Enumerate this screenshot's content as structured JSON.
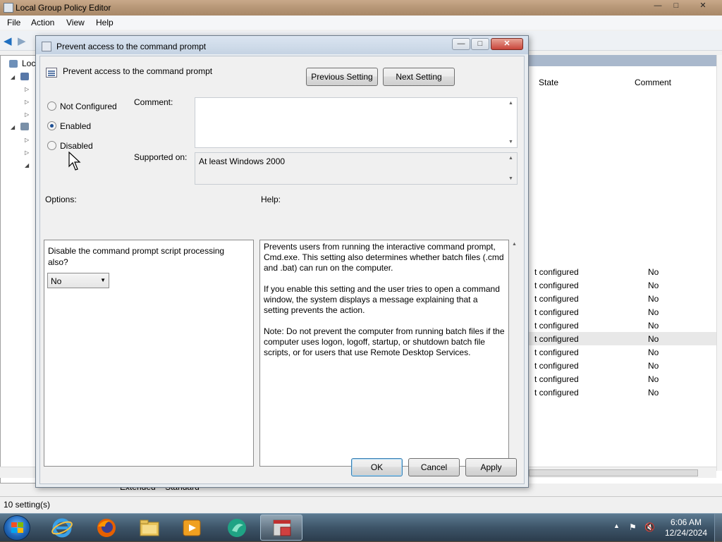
{
  "main_window": {
    "title": "Local Group Policy Editor",
    "menu": [
      "File",
      "Action",
      "View",
      "Help"
    ],
    "tree_label": "Loc",
    "columns": {
      "state": "State",
      "comment": "Comment"
    },
    "rows": [
      {
        "state": "t configured",
        "comment": "No"
      },
      {
        "state": "t configured",
        "comment": "No"
      },
      {
        "state": "t configured",
        "comment": "No"
      },
      {
        "state": "t configured",
        "comment": "No"
      },
      {
        "state": "t configured",
        "comment": "No"
      },
      {
        "state": "t configured",
        "comment": "No"
      },
      {
        "state": "t configured",
        "comment": "No"
      },
      {
        "state": "t configured",
        "comment": "No"
      },
      {
        "state": "t configured",
        "comment": "No"
      },
      {
        "state": "t configured",
        "comment": "No"
      }
    ],
    "selected_row_index": 5,
    "bottom_tabs": [
      "Extended",
      "Standard"
    ],
    "status": "10 setting(s)"
  },
  "dialog": {
    "title": "Prevent access to the command prompt",
    "heading": "Prevent access to the command prompt",
    "previous_button": "Previous Setting",
    "next_button": "Next Setting",
    "radios": [
      {
        "label": "Not Configured",
        "checked": false
      },
      {
        "label": "Enabled",
        "checked": true
      },
      {
        "label": "Disabled",
        "checked": false
      }
    ],
    "comment_label": "Comment:",
    "comment_value": "",
    "supported_label": "Supported on:",
    "supported_value": "At least Windows 2000",
    "options_label": "Options:",
    "help_label": "Help:",
    "option_text": "Disable the command prompt script processing also?",
    "option_select_value": "No",
    "help_paragraphs": [
      "Prevents users from running the interactive command prompt, Cmd.exe. This setting also determines whether batch files (.cmd and .bat) can run on the computer.",
      "If you enable this setting and the user tries to open a command window, the system displays a message explaining that a setting prevents the action.",
      "Note: Do not prevent the computer from running batch files if the computer uses logon, logoff, startup, or shutdown batch file scripts, or for users that use Remote Desktop Services."
    ],
    "ok_button": "OK",
    "cancel_button": "Cancel",
    "apply_button": "Apply"
  },
  "taskbar": {
    "apps": [
      "internet-explorer-icon",
      "firefox-icon",
      "file-explorer-icon",
      "media-player-icon",
      "browser-icon",
      "group-policy-editor-icon"
    ],
    "time": "6:06 AM",
    "date": "12/24/2024"
  },
  "colors": {
    "accent": "#1d4f94",
    "taskbar": "#3d5468",
    "selection": "#e8e8e8"
  }
}
